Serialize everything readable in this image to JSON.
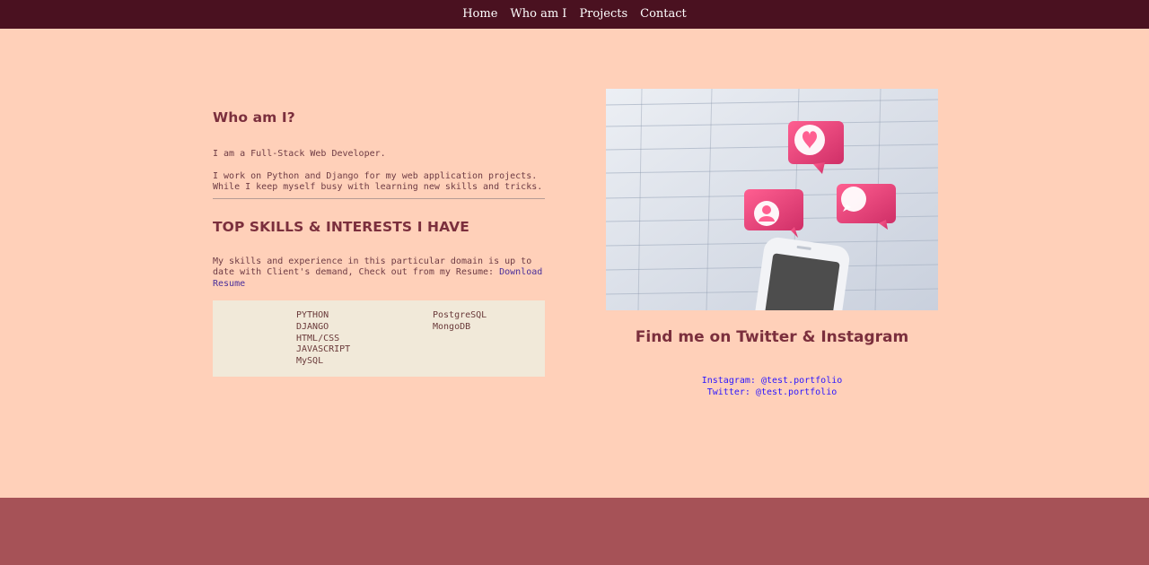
{
  "nav": {
    "items": [
      {
        "label": "Home"
      },
      {
        "label": "Who am I"
      },
      {
        "label": "Projects"
      },
      {
        "label": "Contact"
      }
    ]
  },
  "about": {
    "title": "Who am I?",
    "intro": "I am a Full-Stack Web Developer.",
    "detail": "I work on Python and Django for my web application projects. While I keep myself busy with learning new skills and tricks."
  },
  "skills": {
    "title": "TOP SKILLS & INTERESTS I HAVE",
    "text": "My skills and experience in this particular domain is up to date with Client's demand, Check out from my Resume: ",
    "resume_link": "Download Resume",
    "left": [
      "PYTHON",
      "DJANGO",
      "HTML/CSS",
      "JAVASCRIPT",
      "MySQL"
    ],
    "right": [
      "PostgreSQL",
      "MongoDB"
    ]
  },
  "social": {
    "title": "Find me on Twitter & Instagram",
    "instagram": "Instagram: @test.portfolio",
    "twitter": "Twitter: @test.portfolio"
  }
}
